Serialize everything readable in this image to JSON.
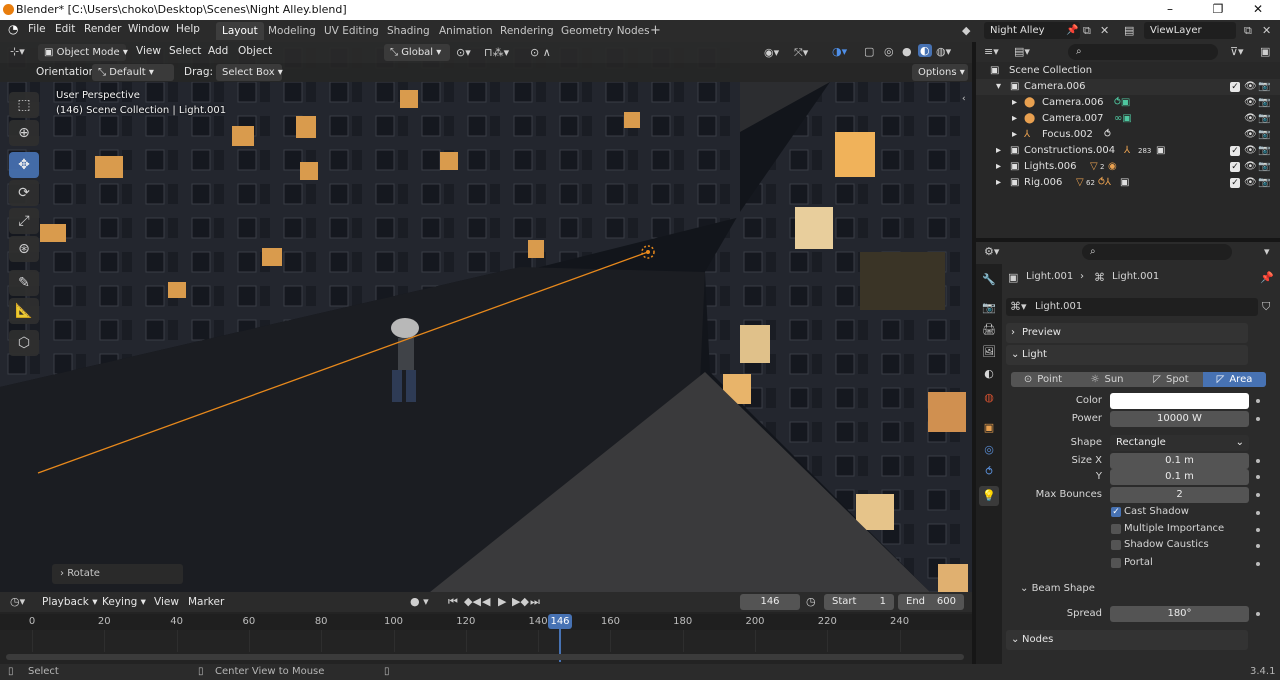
{
  "window": {
    "title": "Blender* [C:\\Users\\choko\\Desktop\\Scenes\\Night Alley.blend]",
    "min": "–",
    "max": "❐",
    "close": "✕"
  },
  "menu": [
    "File",
    "Edit",
    "Render",
    "Window",
    "Help"
  ],
  "workspaces": [
    "Layout",
    "Modeling",
    "UV Editing",
    "Shading",
    "Animation",
    "Rendering",
    "Geometry Nodes"
  ],
  "workspace_add": "+",
  "scene": {
    "name": "Night Alley",
    "view_layer": "ViewLayer"
  },
  "viewport": {
    "mode": "Object Mode",
    "menus": [
      "View",
      "Select",
      "Add",
      "Object"
    ],
    "transform": "Global",
    "orientation_label": "Orientation:",
    "orientation_value": "Default",
    "drag_label": "Drag:",
    "drag_value": "Select Box",
    "options": "Options",
    "overlay_line1": "User Perspective",
    "overlay_line2": "(146) Scene Collection | Light.001",
    "last_op": "Rotate"
  },
  "outliner": {
    "root": "Scene Collection",
    "rows": [
      {
        "name": "Camera.006"
      },
      {
        "name": "Camera.006"
      },
      {
        "name": "Camera.007"
      },
      {
        "name": "Focus.002"
      },
      {
        "name": "Constructions.004",
        "badge": "283"
      },
      {
        "name": "Lights.006",
        "badge": "2"
      },
      {
        "name": "Rig.006",
        "badge": "62"
      }
    ]
  },
  "properties": {
    "breadcrumb_object": "Light.001",
    "breadcrumb_data": "Light.001",
    "datablock": "Light.001",
    "preview": "Preview",
    "light": "Light",
    "types": [
      "Point",
      "Sun",
      "Spot",
      "Area"
    ],
    "active_type": "Area",
    "color_label": "Color",
    "color_value": "#ffffff",
    "power_label": "Power",
    "power": "10000 W",
    "shape_label": "Shape",
    "shape": "Rectangle",
    "sizex_label": "Size X",
    "sizex": "0.1 m",
    "sizey_label": "Y",
    "sizey": "0.1 m",
    "bounces_label": "Max Bounces",
    "bounces": "2",
    "cast_shadow": "Cast Shadow",
    "multiple_importance": "Multiple Importance",
    "shadow_caustics": "Shadow Caustics",
    "portal": "Portal",
    "beam_shape": "Beam Shape",
    "spread_label": "Spread",
    "spread": "180°",
    "nodes": "Nodes"
  },
  "timeline": {
    "menus": [
      "Playback",
      "Keying",
      "View",
      "Marker"
    ],
    "current": "146",
    "start_label": "Start",
    "start": "1",
    "end_label": "End",
    "end": "600",
    "ticks": [
      "0",
      "20",
      "40",
      "60",
      "80",
      "100",
      "120",
      "140",
      "160",
      "180",
      "200",
      "220",
      "240"
    ],
    "playhead": "146"
  },
  "status": {
    "left": "Select",
    "middle": "Center View to Mouse",
    "version": "3.4.1"
  }
}
